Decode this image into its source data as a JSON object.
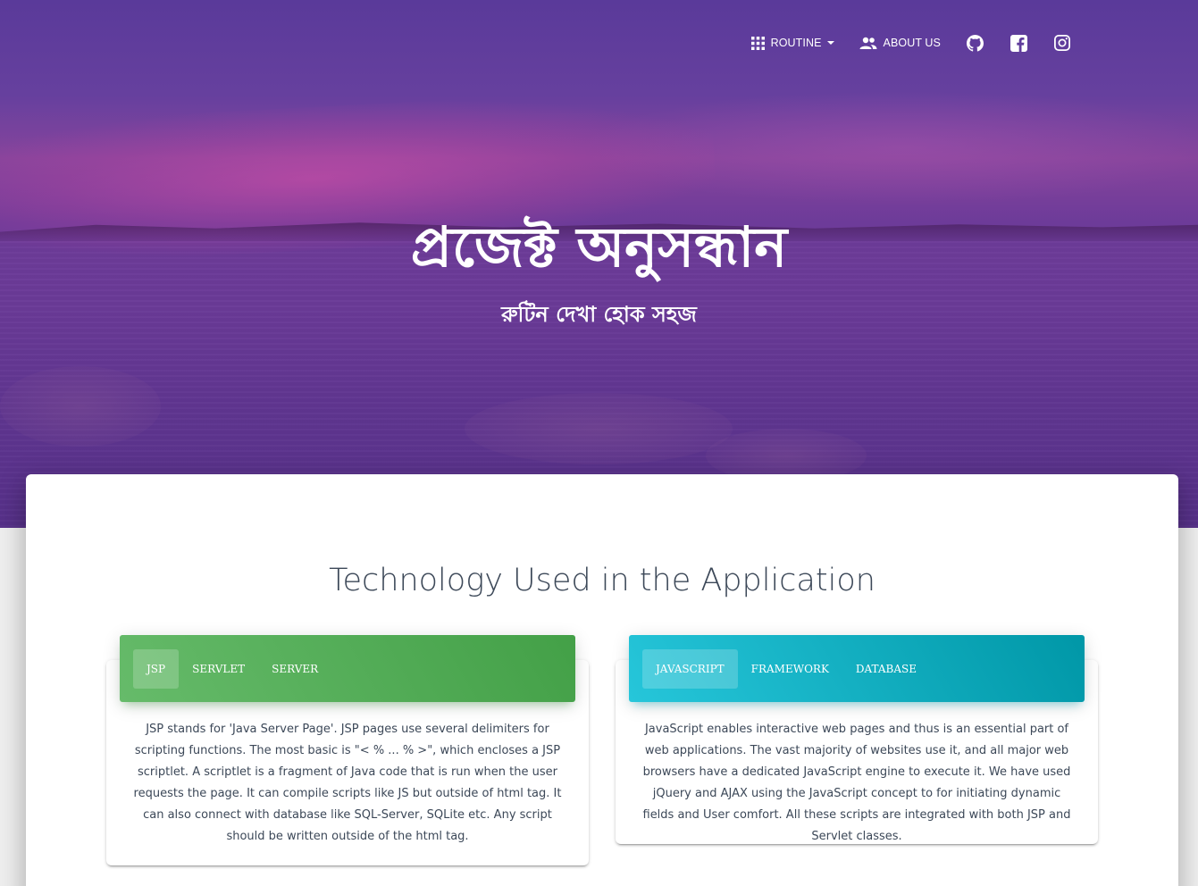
{
  "nav": {
    "items": [
      {
        "label": "ROUTINE",
        "icon": "apps-grid-icon",
        "has_dropdown": true
      },
      {
        "label": "ABOUT US",
        "icon": "people-icon",
        "has_dropdown": false
      }
    ],
    "social_icons": [
      "github-icon",
      "facebook-icon",
      "instagram-icon"
    ]
  },
  "hero": {
    "title": "প্রজেক্ট অনুসন্ধান",
    "subtitle": "রুটিন দেখা হোক সহজ"
  },
  "section": {
    "title": "Technology Used in the Application"
  },
  "cards": [
    {
      "color": "#4caf50",
      "tabs": [
        "JSP",
        "SERVLET",
        "SERVER"
      ],
      "active_tab": 0,
      "body": "JSP stands for 'Java Server Page'. JSP pages use several delimiters for scripting functions. The most basic is \"< % ... % >\", which encloses a JSP scriptlet. A scriptlet is a fragment of Java code that is run when the user requests the page. It can compile scripts like JS but outside of html tag. It can also connect with database like SQL-Server, SQLite etc. Any script should be written outside of the html tag."
    },
    {
      "color": "#00acc1",
      "tabs": [
        "JAVASCRIPT",
        "FRAMEWORK",
        "DATABASE"
      ],
      "active_tab": 0,
      "body": "JavaScript enables interactive web pages and thus is an essential part of web applications. The vast majority of websites use it, and all major web browsers have a dedicated JavaScript engine to execute it. We have used jQuery and AJAX using the JavaScript concept to for initiating dynamic fields and User comfort. All these scripts are integrated with both JSP and Servlet classes."
    }
  ]
}
